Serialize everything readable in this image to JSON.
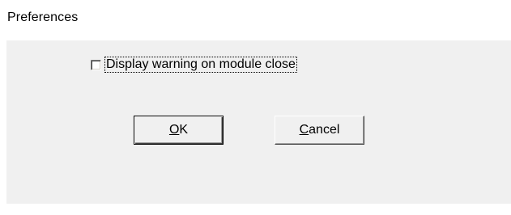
{
  "window": {
    "title": "Preferences"
  },
  "options": {
    "warn_on_close": {
      "label": "Display warning on module close",
      "checked": false
    }
  },
  "buttons": {
    "ok": {
      "mnemonic": "O",
      "rest": "K"
    },
    "cancel": {
      "mnemonic": "C",
      "rest": "ancel"
    }
  },
  "colors": {
    "panel_background": "#f0f0f0",
    "window_background": "#ffffff",
    "text": "#000000"
  }
}
